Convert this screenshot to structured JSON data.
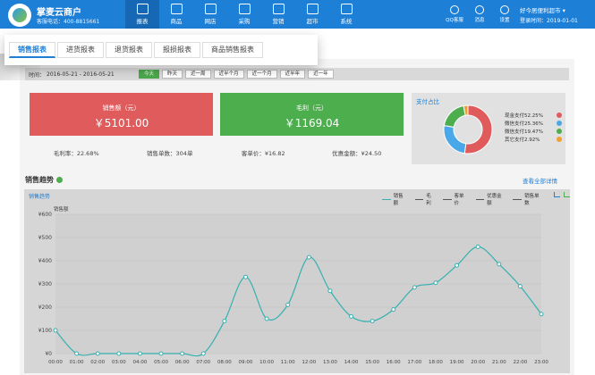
{
  "topbar": {
    "brand": "掌麦云商户",
    "phone": "客服电话：400-8815661",
    "nav": [
      {
        "label": "报表",
        "icon": "report-icon",
        "active": true
      },
      {
        "label": "商品",
        "icon": "grid-icon"
      },
      {
        "label": "网店",
        "icon": "store-icon"
      },
      {
        "label": "采购",
        "icon": "cart-icon"
      },
      {
        "label": "营销",
        "icon": "home-icon"
      },
      {
        "label": "超市",
        "icon": "shop-icon"
      },
      {
        "label": "系统",
        "icon": "info-icon"
      }
    ],
    "right": [
      {
        "label": "QQ客服",
        "icon": "bell-icon"
      },
      {
        "label": "消息",
        "icon": "message-icon"
      },
      {
        "label": "设置",
        "icon": "gear-icon"
      }
    ],
    "user": "好今居便利超市 ▾",
    "date": "登录时间：2019-01-01"
  },
  "tabs": [
    "销售报表",
    "进货报表",
    "退货报表",
    "报损报表",
    "商品销售报表"
  ],
  "filter": {
    "label": "时间：",
    "range": "2016-05-21 - 2016-05-21",
    "chips": [
      "今天",
      "昨天",
      "近一周",
      "近半个月",
      "近一个月",
      "近半年",
      "近一年"
    ]
  },
  "cards": {
    "sales_title": "销售额（元）",
    "sales_value": "￥5101.00",
    "profit_title": "毛利（元）",
    "profit_value": "￥1169.04"
  },
  "stats": [
    "毛利率：22.68%",
    "销售单数：304单",
    "客单价：¥16.82",
    "优惠金额：¥24.50"
  ],
  "payment": {
    "title": "支付占比",
    "items": [
      {
        "name": "现金支付",
        "pct": "52.25%",
        "value": 52.25,
        "color": "#e05b5b"
      },
      {
        "name": "微信支付",
        "pct": "25.36%",
        "value": 25.36,
        "color": "#4aa8e8"
      },
      {
        "name": "微信支付",
        "pct": "19.47%",
        "value": 19.47,
        "color": "#4cae4c"
      },
      {
        "name": "其它支付",
        "pct": "2.92%",
        "value": 2.92,
        "color": "#f0a030"
      }
    ]
  },
  "section": {
    "title": "销售趋势",
    "see_all": "查看全部详情"
  },
  "chart_data": {
    "type": "line",
    "title": "销售趋势",
    "ylabel": "销售额",
    "legend": [
      {
        "name": "销售额",
        "active": true
      },
      {
        "name": "毛利"
      },
      {
        "name": "客单价"
      },
      {
        "name": "优惠金额"
      },
      {
        "name": "销售单数"
      }
    ],
    "ylim": [
      0,
      600
    ],
    "yticks": [
      "¥0",
      "¥100",
      "¥200",
      "¥300",
      "¥400",
      "¥500",
      "¥600"
    ],
    "yvalues": [
      0,
      100,
      200,
      300,
      400,
      500,
      600
    ],
    "categories": [
      "00:00",
      "01:00",
      "02:00",
      "03:00",
      "04:00",
      "05:00",
      "06:00",
      "07:00",
      "08:00",
      "09:00",
      "10:00",
      "11:00",
      "12:00",
      "13:00",
      "14:00",
      "15:00",
      "16:00",
      "17:00",
      "18:00",
      "19:00",
      "20:00",
      "21:00",
      "22:00",
      "23:00"
    ],
    "series": [
      {
        "name": "销售额",
        "color": "#36b0b0",
        "values": [
          100,
          0,
          0,
          0,
          0,
          0,
          0,
          0,
          140,
          330,
          150,
          210,
          415,
          270,
          160,
          140,
          190,
          285,
          305,
          380,
          460,
          385,
          290,
          170
        ]
      }
    ]
  }
}
